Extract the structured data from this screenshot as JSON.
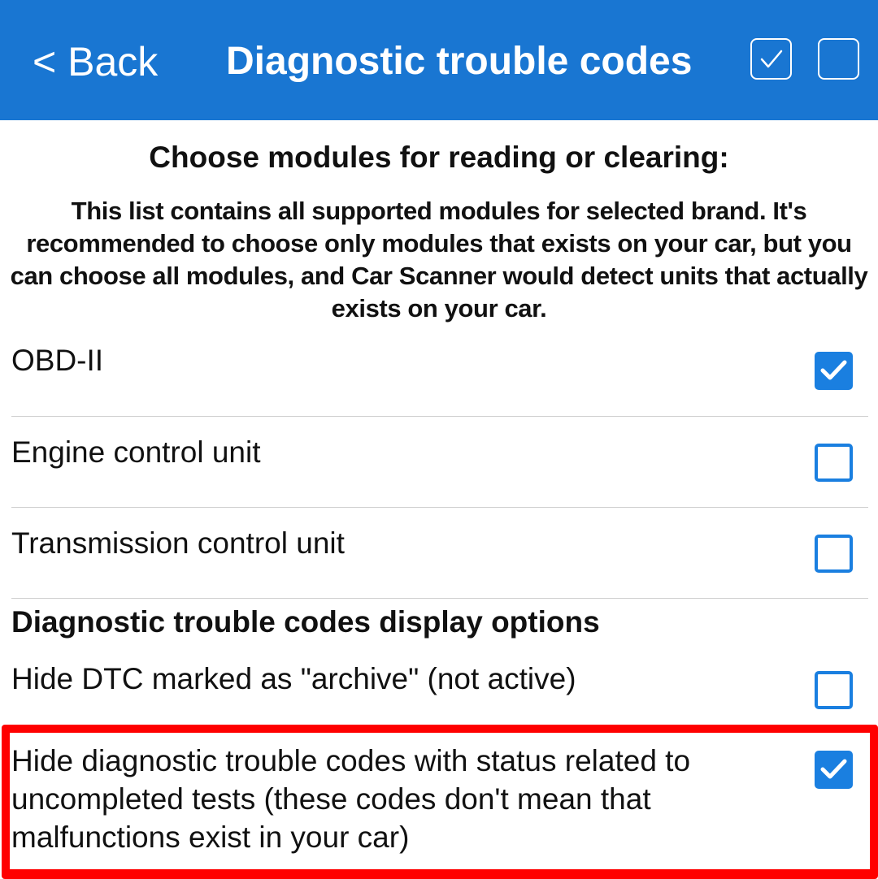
{
  "header": {
    "back_label": "< Back",
    "title": "Diagnostic trouble codes",
    "select_all_icon": "checkbox-checked-icon",
    "deselect_all_icon": "checkbox-empty-icon",
    "bar_color": "#1976d2"
  },
  "intro": {
    "heading": "Choose modules for reading or clearing:",
    "description": "This list contains all supported modules for selected brand. It's recommended to choose only modules that exists on your car, but you can choose all modules, and Car Scanner would detect units that actually exists on your car."
  },
  "modules": [
    {
      "label": "OBD-II",
      "checked": true
    },
    {
      "label": "Engine control unit",
      "checked": false
    },
    {
      "label": "Transmission control unit",
      "checked": false
    }
  ],
  "display_options": {
    "heading": "Diagnostic trouble codes display options",
    "items": [
      {
        "label": "Hide DTC marked as \"archive\" (not active)",
        "checked": false
      },
      {
        "label": "Hide diagnostic trouble codes with status related to uncompleted tests (these codes don't mean that malfunctions exist in your car)",
        "checked": true
      }
    ]
  },
  "colors": {
    "accent": "#1a7fe0",
    "highlight": "#ff0000"
  }
}
